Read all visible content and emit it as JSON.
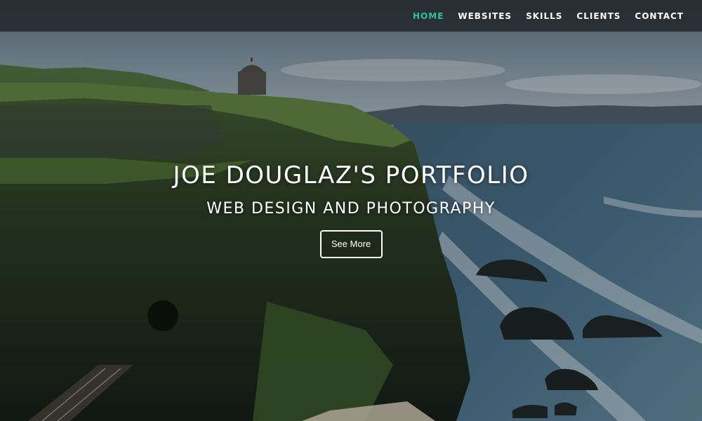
{
  "nav": {
    "items": [
      {
        "label": "HOME",
        "active": true
      },
      {
        "label": "WEBSITES",
        "active": false
      },
      {
        "label": "SKILLS",
        "active": false
      },
      {
        "label": "CLIENTS",
        "active": false
      },
      {
        "label": "CONTACT",
        "active": false
      }
    ],
    "active_color": "#2bbfa3",
    "background": "#262c30"
  },
  "hero": {
    "title": "JOE DOUGLAZ'S PORTFOLIO",
    "subtitle": "WEB DESIGN AND PHOTOGRAPHY",
    "cta_label": "See More"
  }
}
